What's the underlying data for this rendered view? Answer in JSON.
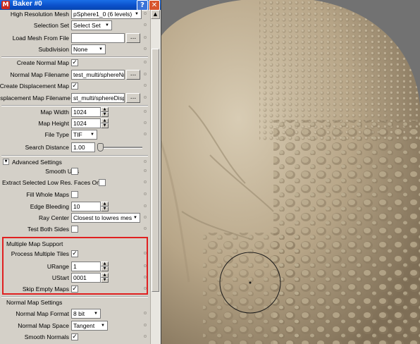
{
  "window": {
    "title": "Baker #0",
    "app_icon": "M",
    "help_label": "?",
    "close_label": "✕"
  },
  "fields": {
    "high_res_mesh": {
      "label": "High Resolution Mesh",
      "value": "pSphere1_0 (6 levels)"
    },
    "selection_set": {
      "label": "Selection Set",
      "value": "Select Set"
    },
    "load_mesh": {
      "label": "Load Mesh From File",
      "value": "",
      "button": "..."
    },
    "subdivision": {
      "label": "Subdivision",
      "value": "None"
    },
    "create_normal_map": {
      "label": "Create Normal Map",
      "checked": true
    },
    "normal_map_filename": {
      "label": "Normal Map Filename",
      "value": "test_multi/sphereNr",
      "button": "..."
    },
    "create_displacement_map": {
      "label": "Create Displacement Map",
      "checked": true
    },
    "displacement_map_filename": {
      "label": "Displacement Map Filename",
      "value": "st_multi/sphereDisp",
      "button": "..."
    },
    "map_width": {
      "label": "Map Width",
      "value": "1024"
    },
    "map_height": {
      "label": "Map Height",
      "value": "1024"
    },
    "file_type": {
      "label": "File Type",
      "value": "TIF"
    },
    "search_distance": {
      "label": "Search Distance",
      "value": "1.00"
    }
  },
  "advanced": {
    "header": "Advanced Settings",
    "smooth_uvs": {
      "label": "Smooth UVs",
      "checked": false
    },
    "extract_selected": {
      "label": "Extract Selected Low Res. Faces Only",
      "checked": false
    },
    "fill_whole_maps": {
      "label": "Fill Whole Maps",
      "checked": false
    },
    "edge_bleeding": {
      "label": "Edge Bleeding",
      "value": "10"
    },
    "ray_center": {
      "label": "Ray Center",
      "value": "Closest to lowres mesh"
    },
    "test_both_sides": {
      "label": "Test Both Sides",
      "checked": false
    }
  },
  "multiple_map": {
    "header": "Multiple Map Support",
    "process_multiple_tiles": {
      "label": "Process Multiple Tiles",
      "checked": true
    },
    "urange": {
      "label": "URange",
      "value": "1"
    },
    "ustart": {
      "label": "UStart",
      "value": "0001"
    },
    "skip_empty_maps": {
      "label": "Skip Empty Maps",
      "checked": true
    }
  },
  "normal_settings": {
    "header": "Normal Map Settings",
    "format": {
      "label": "Normal Map Format",
      "value": "8 bit"
    },
    "space": {
      "label": "Normal Map Space",
      "value": "Tangent"
    },
    "smooth_normals": {
      "label": "Smooth Normals",
      "checked": true
    }
  },
  "glyphs": {
    "check": "✓",
    "arrow_down": "▼",
    "arrow_up": "▲",
    "expand": "▼"
  },
  "colors": {
    "highlight": "#e02020",
    "title_bar": "#0a4fc8",
    "sculpt": "#b5a48a"
  }
}
